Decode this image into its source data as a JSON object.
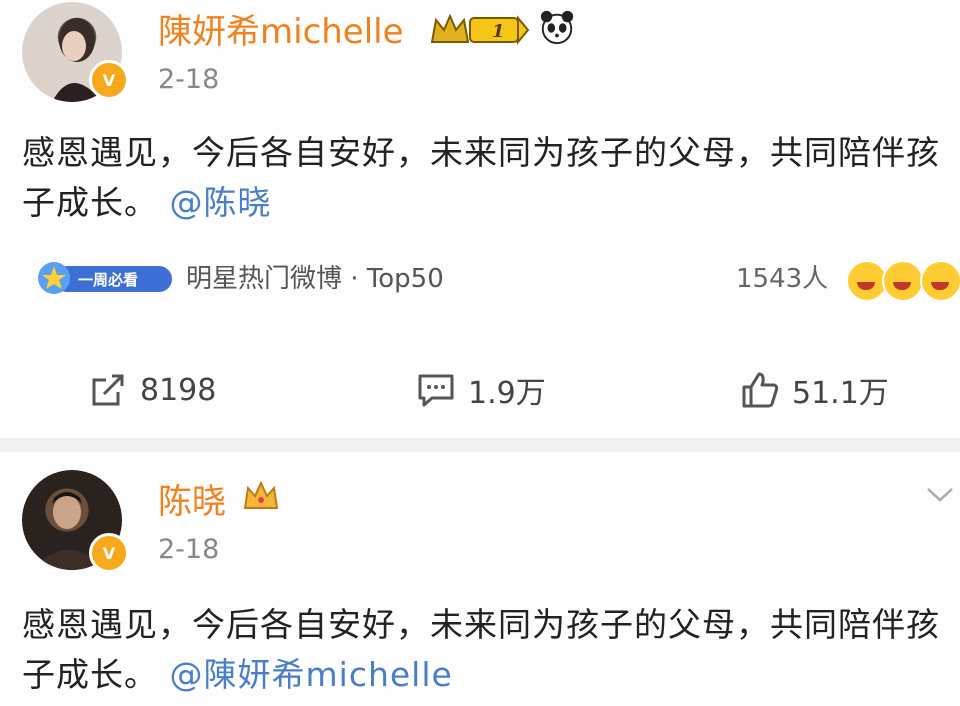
{
  "post1": {
    "author": "陳妍希michelle",
    "badge_level": "1",
    "date": "2-18",
    "text": "感恩遇见，今后各自安好，未来同为孩子的父母，共同陪伴孩子成长。",
    "mention": "@陈晓",
    "topic_badge": "一周必看",
    "topic": "明星热门微博 · Top50",
    "people_count": "1543人",
    "actions": {
      "repost": "8198",
      "comment": "1.9万",
      "like": "51.1万"
    }
  },
  "post2": {
    "author": "陈晓",
    "date": "2-18",
    "text": "感恩遇见，今后各自安好，未来同为孩子的父母，共同陪伴孩子成长。",
    "mention": "@陳妍希michelle"
  },
  "colors": {
    "name": "#f0821e",
    "mention": "#4a7fc7",
    "badge": "#f7a81b"
  }
}
